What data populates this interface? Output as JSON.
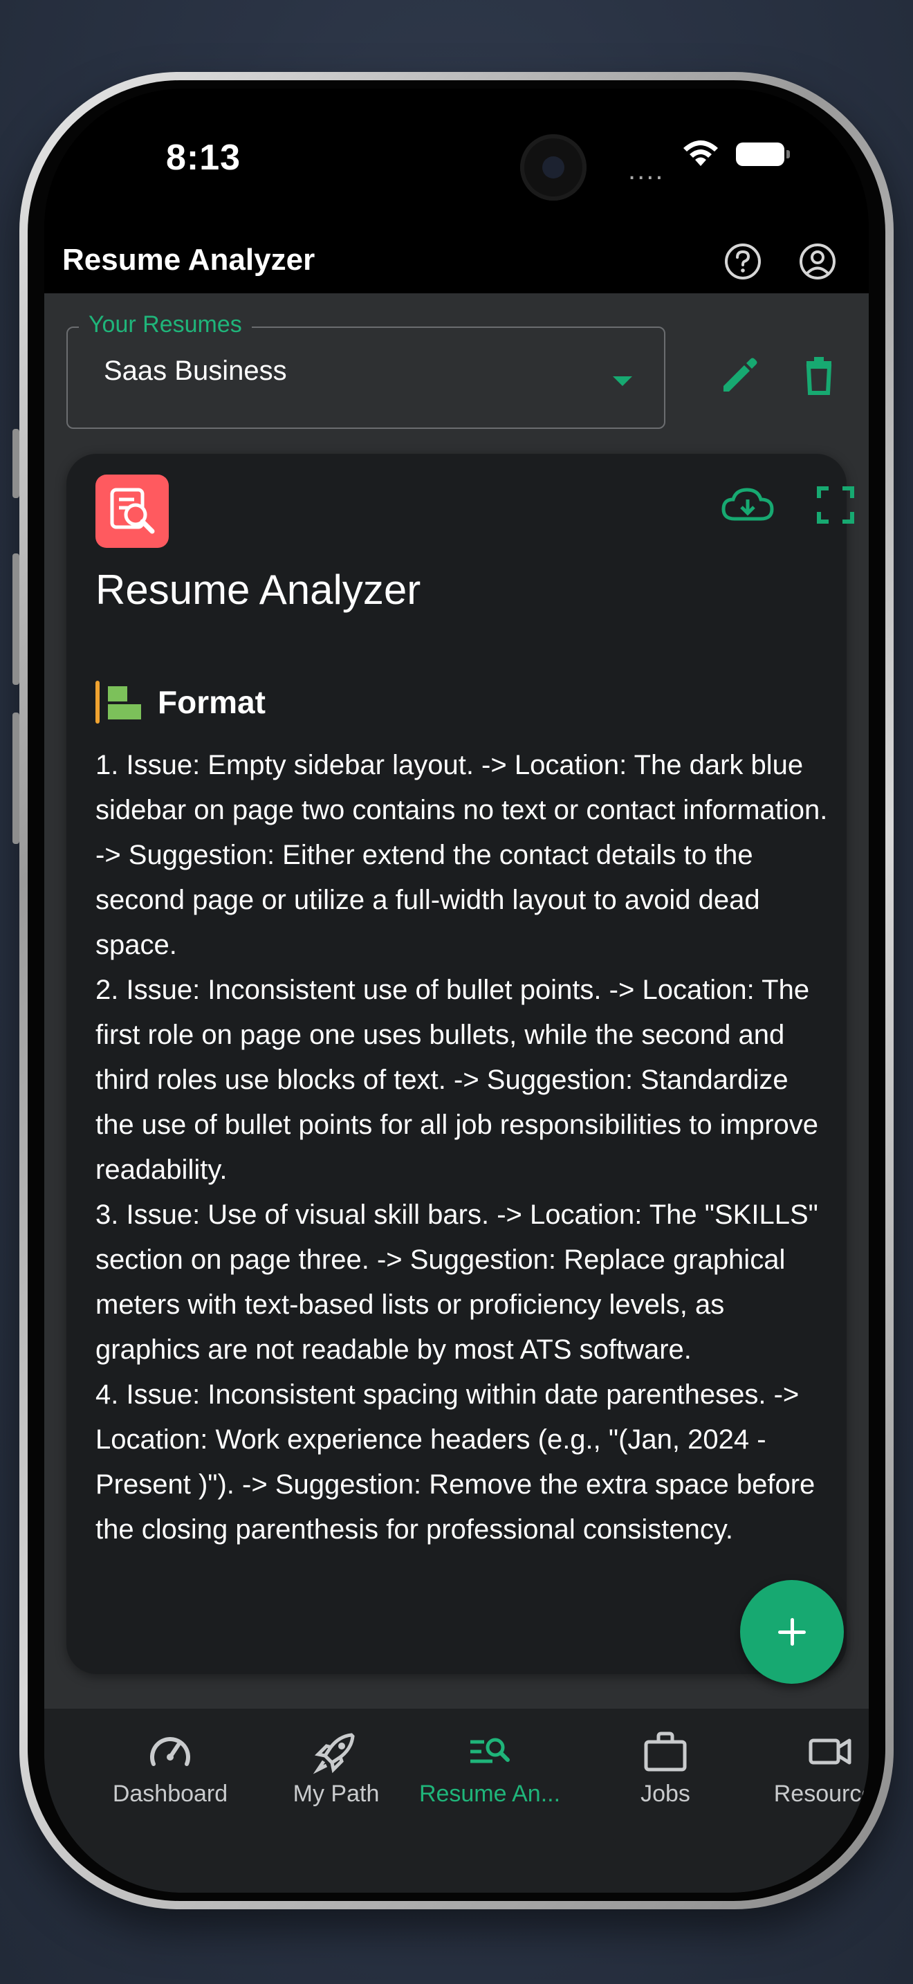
{
  "status_bar": {
    "time": "8:13",
    "signal": "....",
    "wifi_icon": "wifi-icon",
    "battery_icon": "battery-icon"
  },
  "header": {
    "title": "Resume Analyzer",
    "help_icon": "help-circle-icon",
    "account_icon": "account-circle-icon"
  },
  "resume_select": {
    "legend": "Your Resumes",
    "value": "Saas Business",
    "edit_icon": "pencil-icon",
    "delete_icon": "trash-icon"
  },
  "card": {
    "badge_icon": "resume-search-icon",
    "title": "Resume Analyzer",
    "download_icon": "cloud-download-icon",
    "fullscreen_icon": "fullscreen-icon",
    "section": {
      "icon": "format-align-icon",
      "title": "Format",
      "text": "1. Issue: Empty sidebar layout. -> Location: The dark blue sidebar on page two contains no text or contact information. -> Suggestion: Either extend the contact details to the second page or utilize a full-width layout to avoid dead space.\n2. Issue: Inconsistent use of bullet points. -> Location: The first role on page one uses bullets, while the second and third roles use blocks of text. -> Suggestion: Standardize the use of bullet points for all job responsibilities to improve readability.\n3. Issue: Use of visual skill bars. -> Location: The \"SKILLS\" section on page three. -> Suggestion: Replace graphical meters with text-based lists or proficiency levels, as graphics are not readable by most ATS software.\n4. Issue: Inconsistent spacing within date parentheses. -> Location: Work experience headers (e.g., \"(Jan, 2024 - Present )\"). -> Suggestion: Remove the extra space before the closing parenthesis for professional consistency."
    }
  },
  "fab": {
    "icon": "plus-icon"
  },
  "nav": {
    "items": [
      {
        "label": "Dashboard",
        "icon": "speedometer-icon",
        "active": false
      },
      {
        "label": "My Path",
        "icon": "rocket-icon",
        "active": false
      },
      {
        "label": "Resume An...",
        "icon": "list-search-icon",
        "active": true
      },
      {
        "label": "Jobs",
        "icon": "briefcase-icon",
        "active": false
      },
      {
        "label": "Resources",
        "icon": "video-camera-icon",
        "active": false
      }
    ]
  },
  "colors": {
    "accent": "#17a971",
    "badge": "#ff5a5f",
    "section_bar": "#f0a330",
    "card_bg": "#1b1d1f",
    "content_bg": "#2e3032"
  }
}
